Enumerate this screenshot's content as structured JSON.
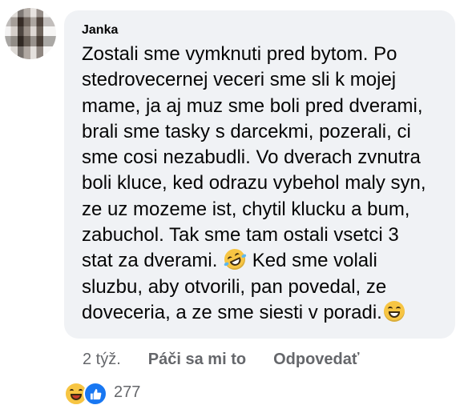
{
  "comment": {
    "author": "Janka",
    "lines": [
      "Zostali sme vymknuti pred bytom. Po",
      "stedrovecernej veceri sme sli k mojej",
      "mame, ja aj muz sme boli pred dverami,",
      "brali sme tasky s darcekmi, pozerali, ci",
      "sme cosi nezabudli. Vo dverach zvnutra",
      "boli kluce, ked odrazu vybehol maly syn,",
      "ze uz mozeme ist, chytil klucku a bum,",
      "zabuchol. Tak sme tam ostali vsetci 3",
      "stat za dverami. ",
      " Ked sme volali",
      "sluzbu, aby otvorili, pan povedal, ze",
      "doveceria, a ze sme siesti v poradi."
    ],
    "emoji": [
      "rofl-face-icon",
      "grinning-face-icon"
    ]
  },
  "actions": {
    "time": "2 týž.",
    "like_label": "Páči sa mi to",
    "reply_label": "Odpovedať"
  },
  "reactions": {
    "count": "277",
    "icons": [
      "haha-reaction-icon",
      "like-reaction-icon"
    ],
    "like_color": "#1877f2",
    "haha_color": "#f7c543"
  },
  "colors": {
    "bubble": "#f0f2f5",
    "text": "#050505",
    "secondary": "#65676b"
  }
}
